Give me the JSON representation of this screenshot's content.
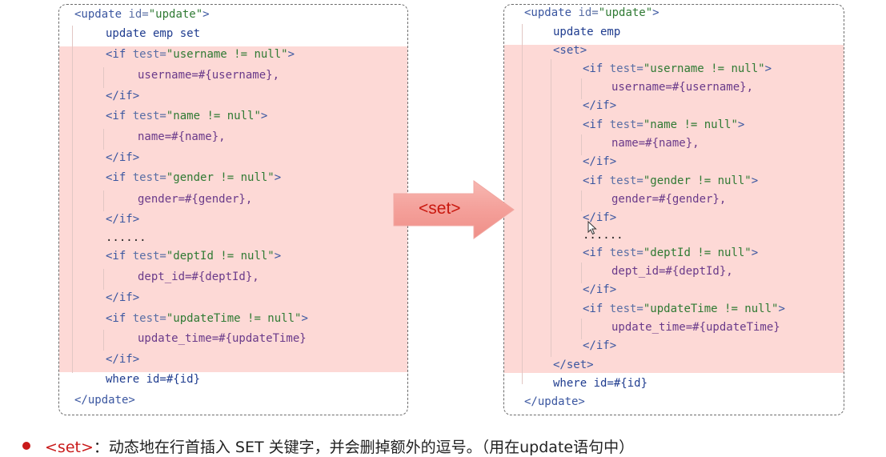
{
  "left_panel": {
    "lines": [
      {
        "tag_open": "<update ",
        "attr": "id=",
        "str": "\"update\"",
        "tag_close": ">"
      },
      {
        "kw": "update emp set"
      },
      {
        "tag_open": "<if ",
        "attr": "test=",
        "str": "\"username != null\"",
        "tag_close": ">"
      },
      {
        "field": "username=#{username},"
      },
      {
        "tag": "</if>"
      },
      {
        "tag_open": "<if ",
        "attr": "test=",
        "str": "\"name != null\"",
        "tag_close": ">"
      },
      {
        "field": "name=#{name},"
      },
      {
        "tag": "</if>"
      },
      {
        "tag_open": "<if ",
        "attr": "test=",
        "str": "\"gender != null\"",
        "tag_close": ">"
      },
      {
        "field": "gender=#{gender},"
      },
      {
        "tag": "</if>"
      },
      {
        "plain": "......"
      },
      {
        "tag_open": "<if ",
        "attr": "test=",
        "str": "\"deptId != null\"",
        "tag_close": ">"
      },
      {
        "field": "dept_id=#{deptId},"
      },
      {
        "tag": "</if>"
      },
      {
        "tag_open": "<if ",
        "attr": "test=",
        "str": "\"updateTime != null\"",
        "tag_close": ">"
      },
      {
        "field": "update_time=#{updateTime}"
      },
      {
        "tag": "</if>"
      },
      {
        "kw": "where id=#{id}"
      },
      {
        "tag": "</update>"
      }
    ]
  },
  "right_panel": {
    "lines": [
      {
        "tag_open": "<update ",
        "attr": "id=",
        "str": "\"update\"",
        "tag_close": ">"
      },
      {
        "kw": "update emp"
      },
      {
        "tag": "<set>"
      },
      {
        "tag_open": "<if ",
        "attr": "test=",
        "str": "\"username != null\"",
        "tag_close": ">"
      },
      {
        "field": "username=#{username},"
      },
      {
        "tag": "</if>"
      },
      {
        "tag_open": "<if ",
        "attr": "test=",
        "str": "\"name != null\"",
        "tag_close": ">"
      },
      {
        "field": "name=#{name},"
      },
      {
        "tag": "</if>"
      },
      {
        "tag_open": "<if ",
        "attr": "test=",
        "str": "\"gender != null\"",
        "tag_close": ">"
      },
      {
        "field": "gender=#{gender},"
      },
      {
        "tag": "</if>"
      },
      {
        "plain": "......"
      },
      {
        "tag_open": "<if ",
        "attr": "test=",
        "str": "\"deptId != null\"",
        "tag_close": ">"
      },
      {
        "field": "dept_id=#{deptId},"
      },
      {
        "tag": "</if>"
      },
      {
        "tag_open": "<if ",
        "attr": "test=",
        "str": "\"updateTime != null\"",
        "tag_close": ">"
      },
      {
        "field": "update_time=#{updateTime}"
      },
      {
        "tag": "</if>"
      },
      {
        "tag": "</set>"
      },
      {
        "kw": "where id=#{id}"
      },
      {
        "tag": "</update>"
      }
    ]
  },
  "arrow": {
    "label": "<set>",
    "fill_color": "#f4a09a",
    "text_color": "#c9180f"
  },
  "highlight_color": "#fdd9d6",
  "note": {
    "keyword": "<set>",
    "text": "：动态地在行首插入 SET 关键字，并会删掉额外的逗号。（用在update语句中）"
  },
  "icons": {
    "bullet": "bullet-dot-icon",
    "cursor": "mouse-cursor-icon"
  }
}
